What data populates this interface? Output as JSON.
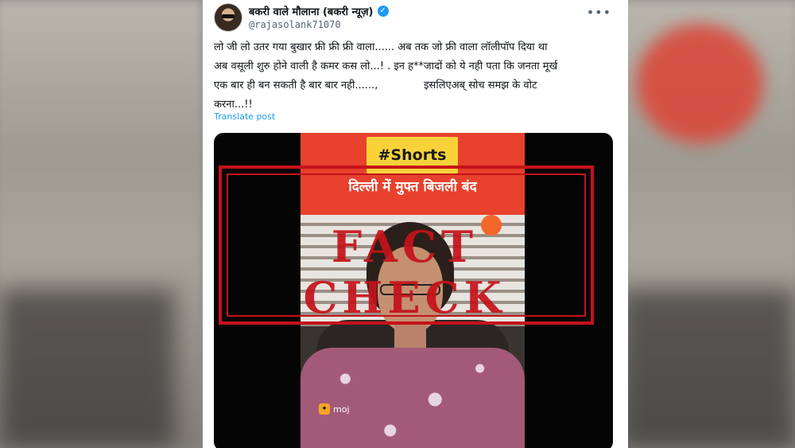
{
  "tweet": {
    "display_name": "बकरी वाले मौलाना (बकरी न्यूज़)",
    "handle": "@rajasolank71070",
    "more_label": "•••",
    "text": "लो जी लो उतर गया बुखार फ्री फ्री फ्री वाला...... अब तक जो फ्री वाला लॉलीपॉप दिया था\nअब वसूली शुरु होने वाली है कमर कस लो...! . इन ह**जादों को ये नही पता कि जनता मूर्ख\nएक बार ही बन सकती है बार बार नही......,              इसलिएअब् सोच समझ के वोट\nकरना...!!",
    "translate_label": "Translate post"
  },
  "media": {
    "shorts_tag": "#Shorts",
    "headline": "दिल्ली में मुफ्त बिजली बंद",
    "stamp_text": "FACT CHECK",
    "watermark": "moj"
  },
  "colors": {
    "stamp_red": "#c5121a",
    "banner_red": "#e8412e",
    "shorts_yellow": "#f9d23a",
    "link_blue": "#1d9bf0"
  },
  "icons": [
    "verified-badge-icon",
    "more-options-icon",
    "moj-logo-icon"
  ]
}
